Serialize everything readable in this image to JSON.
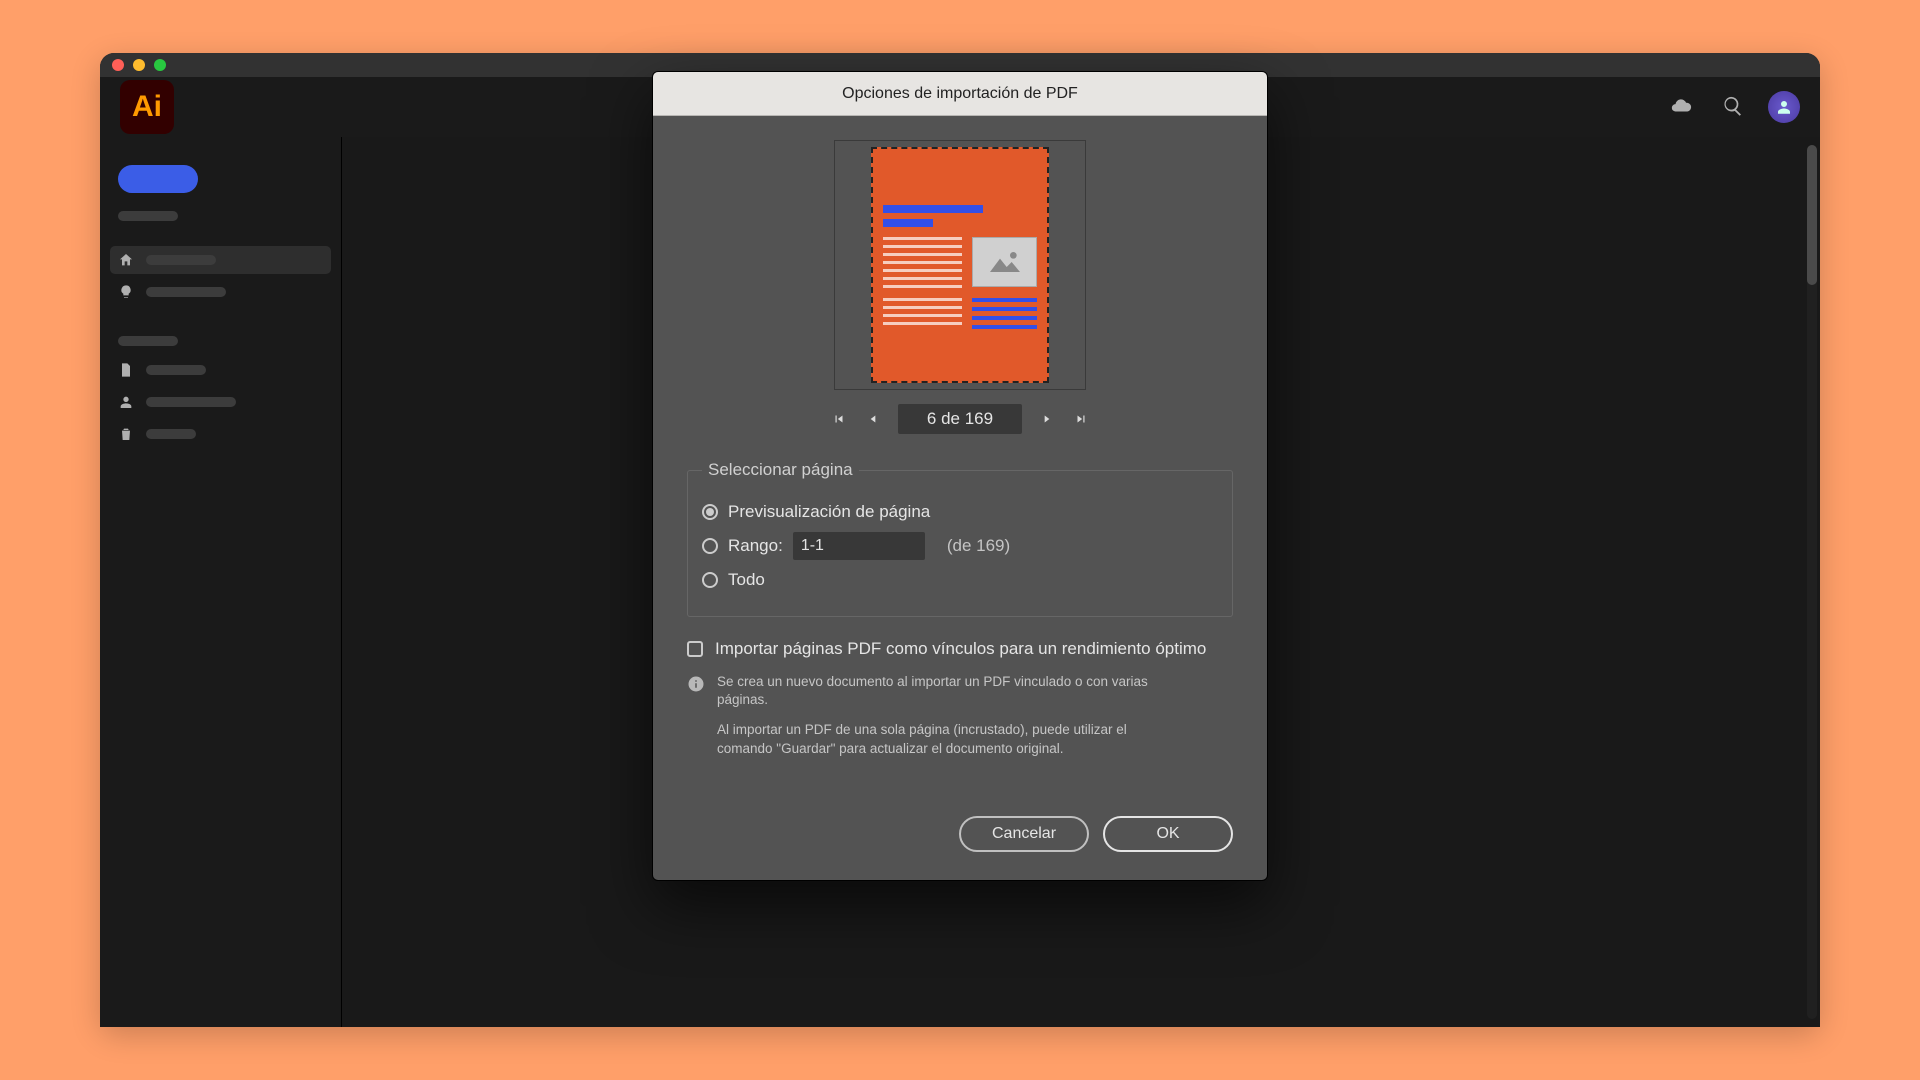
{
  "app": {
    "badge_text": "Ai"
  },
  "dialog": {
    "title": "Opciones de importación de PDF",
    "pager": {
      "current": 6,
      "total": 169,
      "text": "6 de 169"
    },
    "section_label": "Seleccionar página",
    "radios": {
      "preview": "Previsualización de página",
      "range_label": "Rango:",
      "range_value": "1-1",
      "range_of": "(de 169)",
      "all": "Todo",
      "selected": "preview"
    },
    "checkbox_label": "Importar páginas PDF como vínculos para un rendimiento óptimo",
    "info1": "Se crea un nuevo documento al importar un PDF vinculado o con varias páginas.",
    "info2": "Al importar un PDF de una sola página (incrustado), puede utilizar el comando \"Guardar\" para actualizar el documento original.",
    "buttons": {
      "cancel": "Cancelar",
      "ok": "OK"
    }
  }
}
